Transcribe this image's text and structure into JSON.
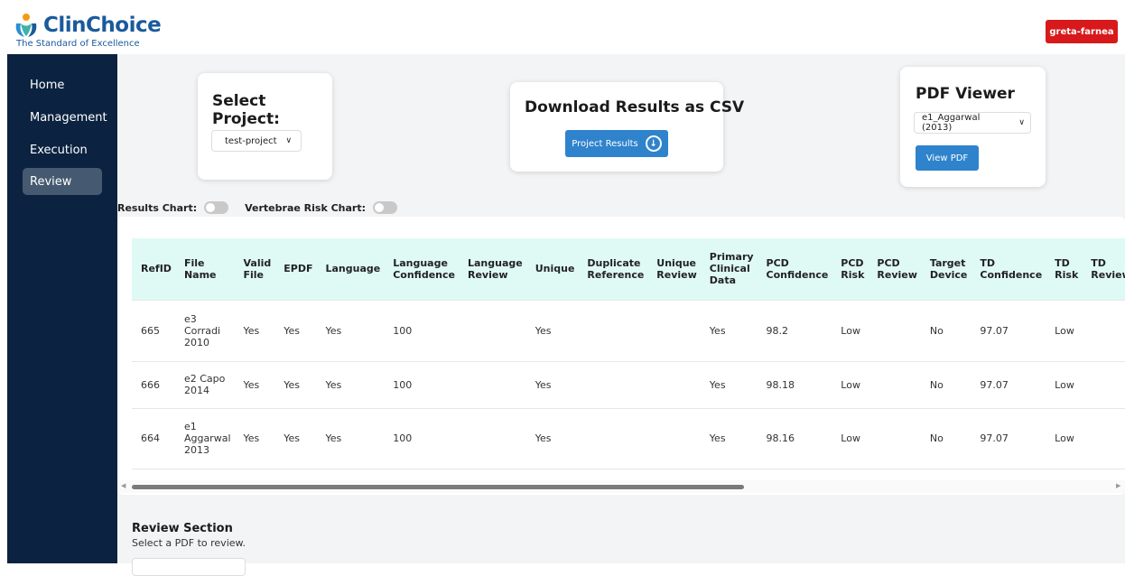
{
  "brand": {
    "name": "ClinChoice",
    "tagline": "The Standard of Excellence"
  },
  "user": {
    "name": "greta-farnea"
  },
  "sidebar": {
    "items": [
      {
        "label": "Home",
        "active": false
      },
      {
        "label": "Management",
        "active": false
      },
      {
        "label": "Execution",
        "active": false
      },
      {
        "label": "Review",
        "active": true
      }
    ]
  },
  "select_project": {
    "title": "Select Project:",
    "selected": "test-project"
  },
  "download": {
    "title": "Download Results as CSV",
    "button_label": "Project Results"
  },
  "pdf_viewer": {
    "title": "PDF Viewer",
    "selected": "e1_Aggarwal (2013)",
    "button_label": "View PDF"
  },
  "toggles": {
    "results_chart": "Results Chart:",
    "vertebrae_chart": "Vertebrae Risk Chart:"
  },
  "table": {
    "headers": [
      "RefID",
      "File Name",
      "Valid File",
      "EPDF",
      "Language",
      "Language Confidence",
      "Language Review",
      "Unique",
      "Duplicate Reference",
      "Unique Review",
      "Primary Clinical Data",
      "PCD Confidence",
      "PCD Risk",
      "PCD Review",
      "Target Device",
      "TD Confidence",
      "TD Risk",
      "TD Review"
    ],
    "rows": [
      [
        "665",
        "e3 Corradi 2010",
        "Yes",
        "Yes",
        "Yes",
        "100",
        "",
        "Yes",
        "",
        "",
        "Yes",
        "98.2",
        "Low",
        "",
        "No",
        "97.07",
        "Low",
        ""
      ],
      [
        "666",
        "e2 Capo 2014",
        "Yes",
        "Yes",
        "Yes",
        "100",
        "",
        "Yes",
        "",
        "",
        "Yes",
        "98.18",
        "Low",
        "",
        "No",
        "97.07",
        "Low",
        ""
      ],
      [
        "664",
        "e1 Aggarwal 2013",
        "Yes",
        "Yes",
        "Yes",
        "100",
        "",
        "Yes",
        "",
        "",
        "Yes",
        "98.16",
        "Low",
        "",
        "No",
        "97.07",
        "Low",
        ""
      ]
    ]
  },
  "review": {
    "title": "Review Section",
    "subtitle": "Select a PDF to review."
  },
  "colors": {
    "sidebar_bg": "#0b2240",
    "brand_blue": "#1a5a9c",
    "user_badge": "#d7191c",
    "button_blue": "#2f83cc",
    "table_header_bg": "#dffaf5"
  },
  "icons": {
    "logo": "clinchoice-logo-icon",
    "download": "download-circle-icon",
    "dropdown": "chevron-down-icon"
  }
}
